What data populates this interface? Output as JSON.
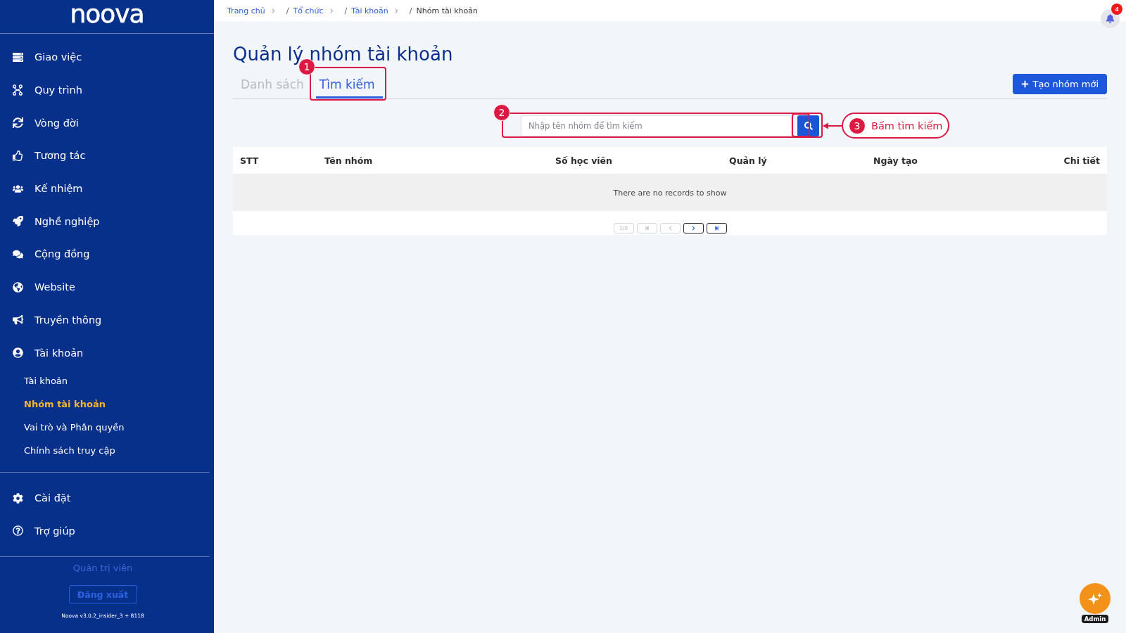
{
  "sidebar": {
    "logo": "noova",
    "items": [
      {
        "label": "Giao việc",
        "selected": false
      },
      {
        "label": "Quy trình",
        "selected": false
      },
      {
        "label": "Vòng đời",
        "selected": false
      },
      {
        "label": "Tương tác",
        "selected": false
      },
      {
        "label": "Kế nhiệm",
        "selected": false
      },
      {
        "label": "Nghề nghiệp",
        "selected": false
      },
      {
        "label": "Cộng đồng",
        "selected": false
      },
      {
        "label": "Website",
        "selected": false
      },
      {
        "label": "Truyền thông",
        "selected": false
      },
      {
        "label": "Tài khoản",
        "selected": false,
        "children": [
          {
            "label": "Tài khoản",
            "selected": false
          },
          {
            "label": "Nhóm tài khoản",
            "selected": true
          },
          {
            "label": "Vai trò và Phân quyền",
            "selected": false
          },
          {
            "label": "Chính sách truy cập",
            "selected": false
          }
        ]
      }
    ],
    "footer_items": [
      {
        "label": "Cài đặt",
        "selected": false
      },
      {
        "label": "Trợ giúp",
        "selected": false
      }
    ],
    "user_role": "Quản trị viên",
    "logout_button": "Đăng xuất",
    "version": "Noova v3.0.2_insider_3 + 8118"
  },
  "breadcrumb": [
    {
      "label": "Trang chủ",
      "current": false
    },
    {
      "separator": "/",
      "label": "Tổ chức",
      "current": false
    },
    {
      "separator": "/",
      "label": "Tài khoản",
      "current": false
    },
    {
      "separator": "/",
      "label": "Nhóm tài khoản",
      "current": true
    }
  ],
  "notifications": {
    "count": "4"
  },
  "page": {
    "title": "Quản lý nhóm tài khoản",
    "tabs": [
      {
        "label": "Danh sách",
        "selected": false
      },
      {
        "label": "Tìm kiếm",
        "selected": true
      }
    ],
    "create_button": "Tạo nhóm mới",
    "search": {
      "placeholder": "Nhập tên nhóm để tìm kiếm"
    },
    "table": {
      "columns": [
        "STT",
        "Tên nhóm",
        "Số học viên",
        "Quản lý",
        "Ngày tạo",
        "Chi tiết"
      ],
      "empty_message": "There are no records to show",
      "pagination": {
        "page_info": "1/0",
        "buttons": [
          {
            "kind": "first",
            "disabled": true
          },
          {
            "kind": "previous",
            "disabled": true
          },
          {
            "kind": "next",
            "disabled": false
          },
          {
            "kind": "last",
            "disabled": false
          }
        ]
      }
    }
  },
  "annotations": [
    {
      "number": "1",
      "kind": "tab"
    },
    {
      "number": "2",
      "kind": "field"
    },
    {
      "number": "3",
      "kind": "callout",
      "text": "Bấm tìm kiếm"
    }
  ],
  "assistant": {
    "label": "Admin"
  }
}
